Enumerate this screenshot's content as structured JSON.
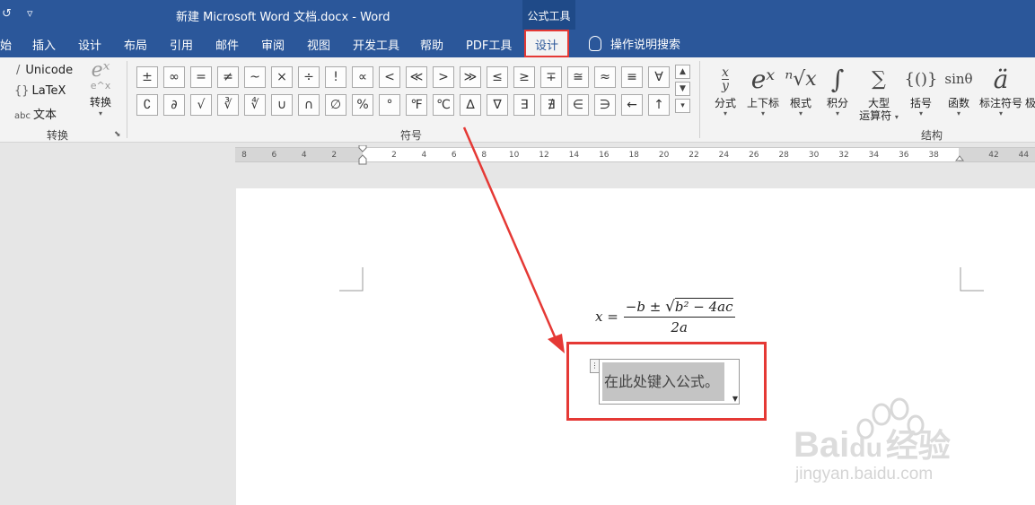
{
  "titlebar": {
    "title": "新建 Microsoft Word 文档.docx  -  Word",
    "context_group": "公式工具",
    "qa_undo": "↺",
    "qa_customize": "▿"
  },
  "tabs": [
    {
      "label": "始"
    },
    {
      "label": "插入"
    },
    {
      "label": "设计"
    },
    {
      "label": "布局"
    },
    {
      "label": "引用"
    },
    {
      "label": "邮件"
    },
    {
      "label": "审阅"
    },
    {
      "label": "视图"
    },
    {
      "label": "开发工具"
    },
    {
      "label": "帮助"
    },
    {
      "label": "PDF工具"
    },
    {
      "label": "设计",
      "active": true
    }
  ],
  "tell_me": "操作说明搜索",
  "ribbon": {
    "conversion": {
      "unicode": "Unicode",
      "latex": "LaTeX",
      "text_prefix": "abc",
      "text": "文本",
      "convert_label": "转换",
      "group_label": "转换",
      "convert_glyph_top": "eˣ",
      "convert_glyph_bottom": "e^x"
    },
    "symbols": {
      "group_label": "符号",
      "row1": [
        "±",
        "∞",
        "=",
        "≠",
        "~",
        "×",
        "÷",
        "!",
        "∝",
        "<",
        "≪",
        ">",
        "≫",
        "≤",
        "≥",
        "∓",
        "≅",
        "≈",
        "≡",
        "∀"
      ],
      "row2": [
        "∁",
        "∂",
        "√",
        "∛",
        "∜",
        "∪",
        "∩",
        "∅",
        "%",
        "°",
        "℉",
        "℃",
        "∆",
        "∇",
        "∃",
        "∄",
        "∈",
        "∋",
        "←",
        "↑"
      ],
      "scroll_up": "▲",
      "scroll_down": "▼",
      "more": "▾"
    },
    "structures": {
      "group_label": "结构",
      "items": [
        {
          "label": "分式",
          "glyph": "x/y"
        },
        {
          "label": "上下标",
          "glyph": "eˣ"
        },
        {
          "label": "根式",
          "glyph": "ⁿ√x"
        },
        {
          "label": "积分",
          "glyph": "∫"
        },
        {
          "label": "大型运算符",
          "label2": "运算符",
          "label1": "大型",
          "glyph": "∑"
        },
        {
          "label": "括号",
          "glyph": "{()}"
        },
        {
          "label": "函数",
          "glyph": "sinθ"
        },
        {
          "label": "标注符号",
          "glyph": "ä"
        },
        {
          "label": "极",
          "glyph": ""
        }
      ]
    }
  },
  "ruler": {
    "ticks": [
      "8",
      "6",
      "4",
      "2",
      "",
      "2",
      "4",
      "6",
      "8",
      "10",
      "12",
      "14",
      "16",
      "18",
      "20",
      "22",
      "24",
      "26",
      "28",
      "30",
      "32",
      "34",
      "36",
      "38",
      "",
      "42",
      "44"
    ]
  },
  "document": {
    "formula_lhs": "x =",
    "formula_num_pre": "−b ± ",
    "formula_radicand": "b² − 4ac",
    "formula_den": "2a",
    "placeholder": "在此处键入公式。"
  },
  "watermark": {
    "brand": "Bai",
    "brand2": "du",
    "brand_cn": "经验",
    "url": "jingyan.baidu.com"
  },
  "colors": {
    "word_blue": "#2b579a",
    "highlight_red": "#e53935",
    "ribbon_bg": "#f3f3f3"
  }
}
